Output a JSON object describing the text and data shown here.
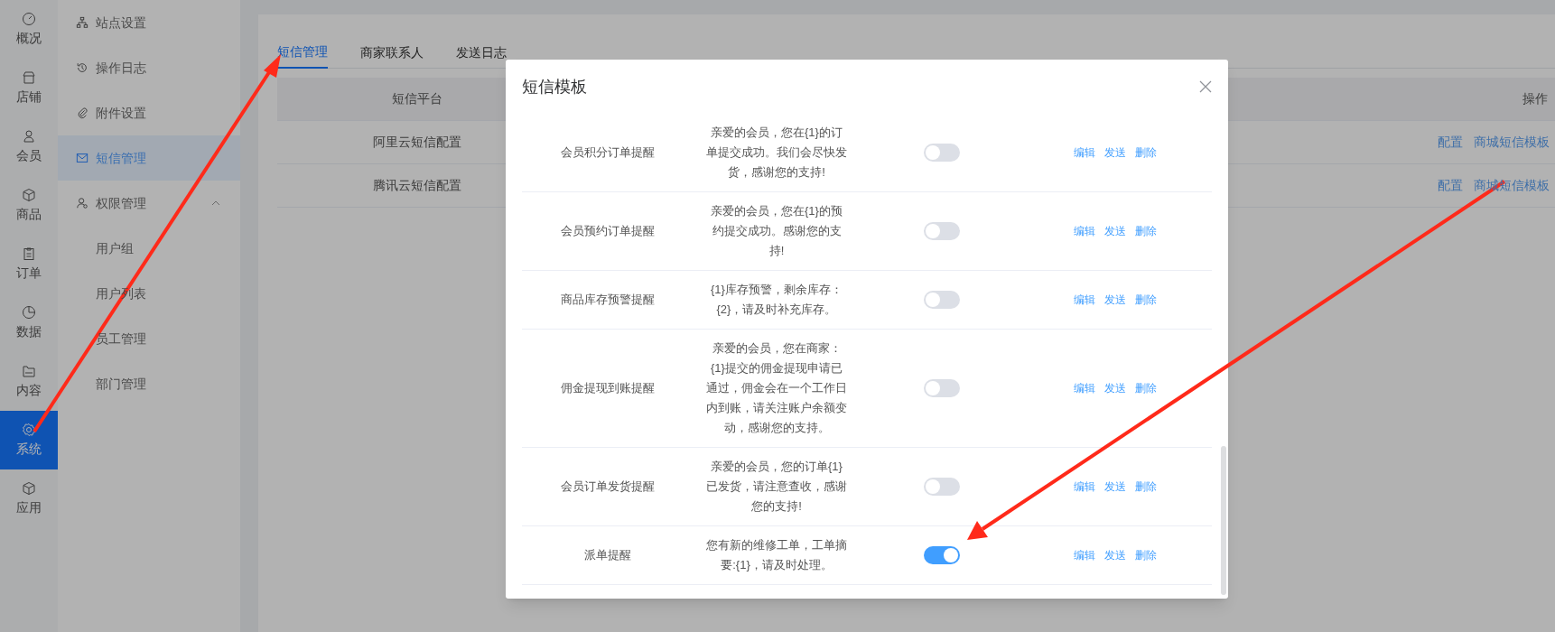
{
  "rail": [
    {
      "label": "概况",
      "selected": false
    },
    {
      "label": "店铺",
      "selected": false
    },
    {
      "label": "会员",
      "selected": false
    },
    {
      "label": "商品",
      "selected": false
    },
    {
      "label": "订单",
      "selected": false
    },
    {
      "label": "数据",
      "selected": false
    },
    {
      "label": "内容",
      "selected": false
    },
    {
      "label": "系统",
      "selected": true
    },
    {
      "label": "应用",
      "selected": false
    }
  ],
  "sidebar": [
    {
      "label": "站点设置",
      "selected": false
    },
    {
      "label": "操作日志",
      "selected": false
    },
    {
      "label": "附件设置",
      "selected": false
    },
    {
      "label": "短信管理",
      "selected": true
    },
    {
      "label": "权限管理",
      "selected": false,
      "expanded": true,
      "children": [
        {
          "label": "用户组",
          "selected": false
        },
        {
          "label": "用户列表",
          "selected": false
        },
        {
          "label": "员工管理",
          "selected": false
        },
        {
          "label": "部门管理",
          "selected": false
        }
      ]
    }
  ],
  "tabs": [
    {
      "label": "短信管理",
      "selected": true
    },
    {
      "label": "商家联系人",
      "selected": false
    },
    {
      "label": "发送日志",
      "selected": false
    }
  ],
  "table": {
    "columns": [
      "短信平台",
      "操作"
    ],
    "rows": [
      {
        "platform": "阿里云短信配置",
        "actions": [
          "配置",
          "商城短信模板"
        ]
      },
      {
        "platform": "腾讯云短信配置",
        "actions": [
          "配置",
          "商城短信模板"
        ]
      }
    ]
  },
  "modal": {
    "title": "短信模板",
    "rows": [
      {
        "name": "会员积分订单提醒",
        "content": "亲爱的会员，您在{1}的订单提交成功。我们会尽快发货，感谢您的支持!",
        "enabled": false,
        "actions": [
          "编辑",
          "发送",
          "删除"
        ]
      },
      {
        "name": "会员预约订单提醒",
        "content": "亲爱的会员，您在{1}的预约提交成功。感谢您的支持!",
        "enabled": false,
        "actions": [
          "编辑",
          "发送",
          "删除"
        ]
      },
      {
        "name": "商品库存预警提醒",
        "content": "{1}库存预警，剩余库存：{2}，请及时补充库存。",
        "enabled": false,
        "actions": [
          "编辑",
          "发送",
          "删除"
        ]
      },
      {
        "name": "佣金提现到账提醒",
        "content": "亲爱的会员，您在商家：{1}提交的佣金提现申请已通过，佣金会在一个工作日内到账，请关注账户余额变动，感谢您的支持。",
        "enabled": false,
        "actions": [
          "编辑",
          "发送",
          "删除"
        ]
      },
      {
        "name": "会员订单发货提醒",
        "content": "亲爱的会员，您的订单{1}已发货，请注意查收，感谢您的支持!",
        "enabled": false,
        "actions": [
          "编辑",
          "发送",
          "删除"
        ]
      },
      {
        "name": "派单提醒",
        "content": "您有新的维修工单，工单摘要:{1}，请及时处理。",
        "enabled": true,
        "actions": [
          "编辑",
          "发送",
          "删除"
        ]
      }
    ]
  }
}
